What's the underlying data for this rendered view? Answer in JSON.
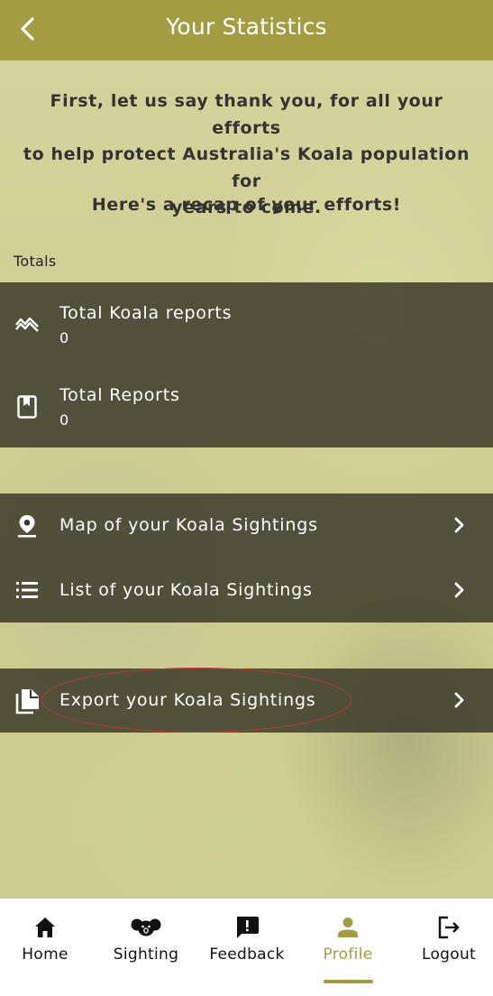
{
  "header": {
    "title": "Your Statistics"
  },
  "intro": {
    "lines": [
      "First, let us say thank you, for all your efforts",
      "to help protect Australia's Koala population for",
      "years to come."
    ],
    "recap": "Here's a recap of your efforts!"
  },
  "totals": {
    "section_label": "Totals",
    "items": [
      {
        "label": "Total Koala reports",
        "value": "0",
        "icon": "trend-icon"
      },
      {
        "label": "Total Reports",
        "value": "0",
        "icon": "report-book-icon"
      }
    ]
  },
  "links": [
    {
      "label": "Map of your Koala Sightings",
      "icon": "map-pin-icon"
    },
    {
      "label": "List of your Koala Sightings",
      "icon": "list-icon"
    }
  ],
  "export": {
    "label": "Export your Koala Sightings",
    "icon": "file-copy-icon"
  },
  "tabs": [
    {
      "label": "Home",
      "icon": "home-icon"
    },
    {
      "label": "Sighting",
      "icon": "koala-icon"
    },
    {
      "label": "Feedback",
      "icon": "feedback-icon"
    },
    {
      "label": "Profile",
      "icon": "person-icon",
      "active": true
    },
    {
      "label": "Logout",
      "icon": "logout-icon"
    }
  ],
  "colors": {
    "accent": "#a39c43",
    "panel": "#3a3928",
    "background": "#ccc98f",
    "annotation": "#c43a32"
  }
}
